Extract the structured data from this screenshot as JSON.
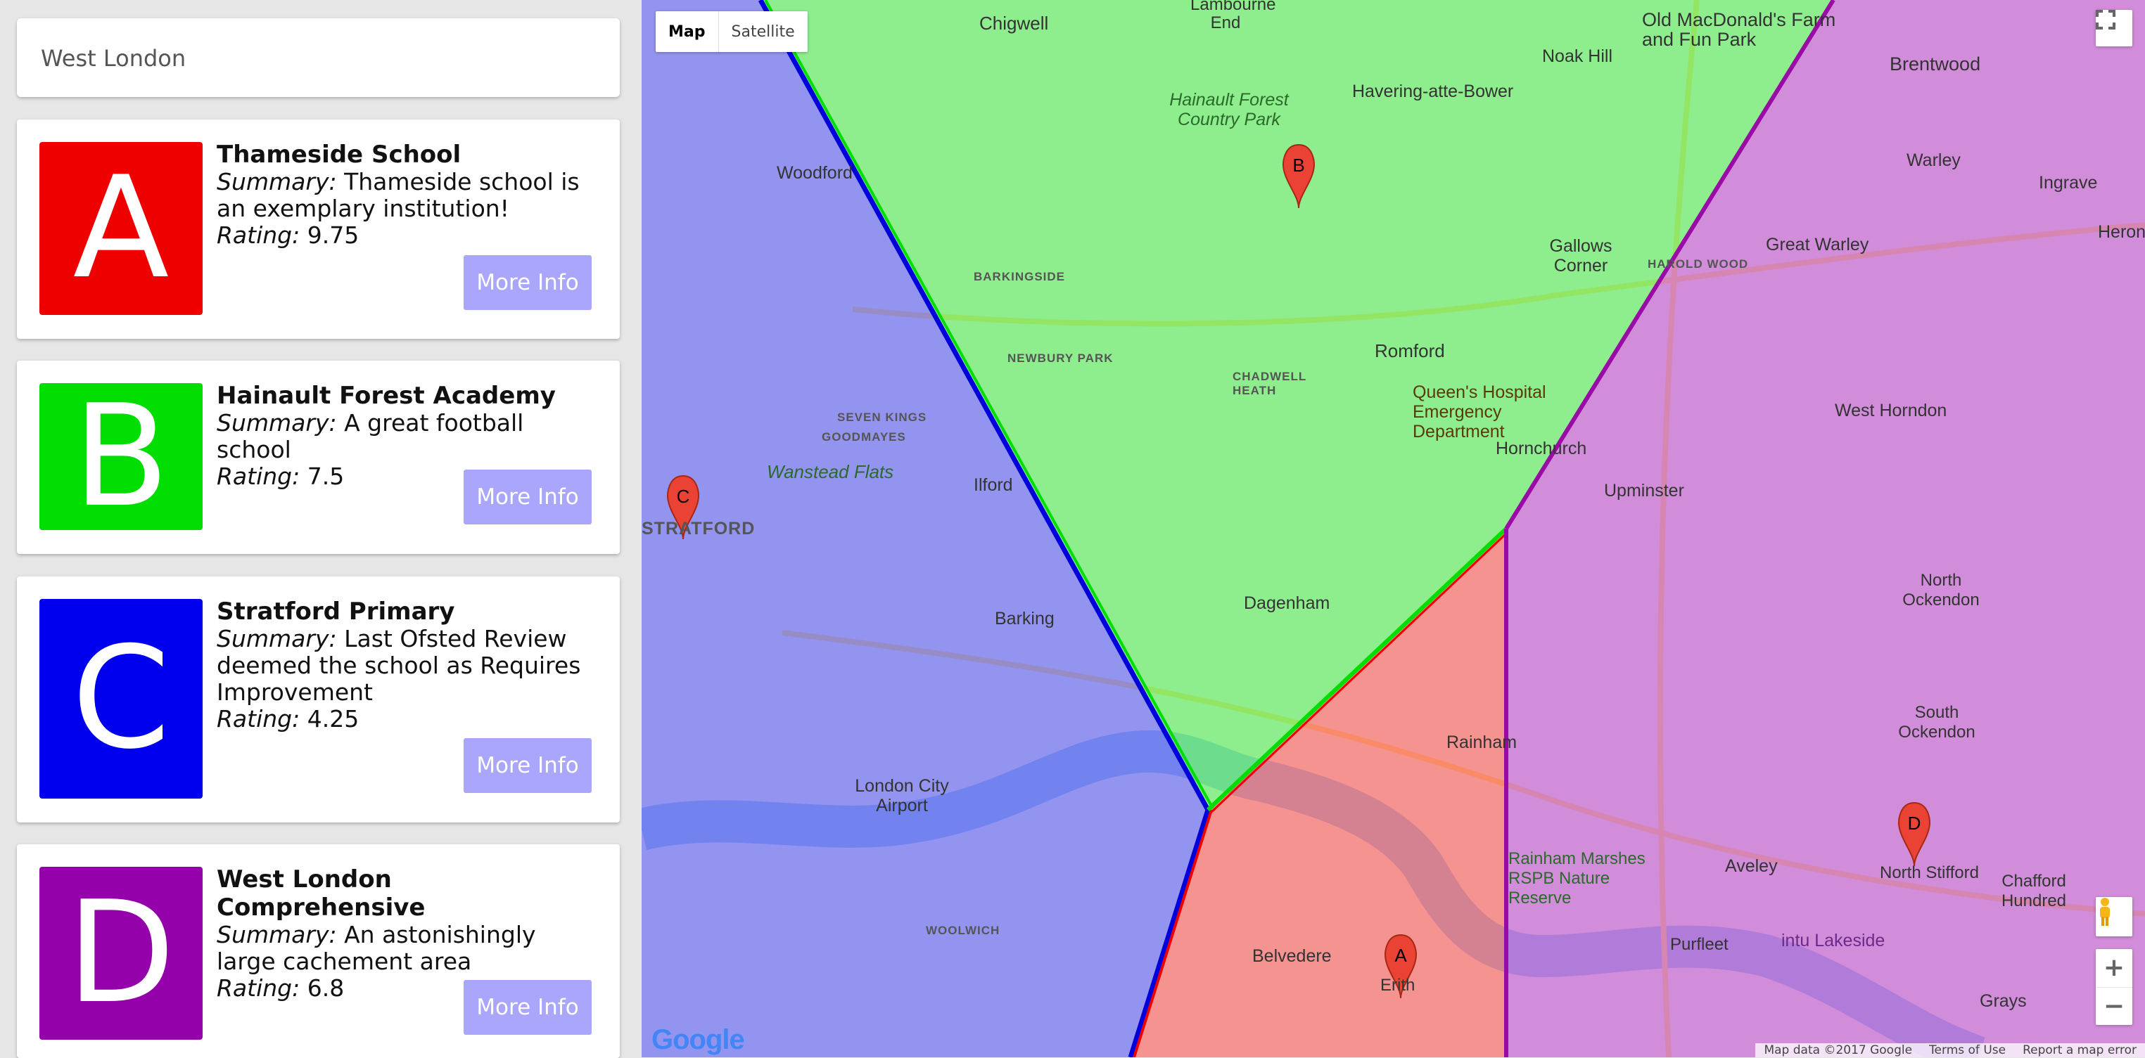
{
  "search": {
    "value": "West London"
  },
  "schools": [
    {
      "letter": "A",
      "color": "#ee0000",
      "name": "Thameside School",
      "summary_label": "Summary:",
      "summary": "Thameside school is an exemplary institution!",
      "rating_label": "Rating:",
      "rating": "9.75",
      "button": "More Info"
    },
    {
      "letter": "B",
      "color": "#00dd00",
      "name": "Hainault Forest Academy",
      "summary_label": "Summary:",
      "summary": "A great football school",
      "rating_label": "Rating:",
      "rating": "7.5",
      "button": "More Info"
    },
    {
      "letter": "C",
      "color": "#0000ee",
      "name": "Stratford Primary",
      "summary_label": "Summary:",
      "summary": "Last Ofsted Review deemed the school as Requires Improvement",
      "rating_label": "Rating:",
      "rating": "4.25",
      "button": "More Info"
    },
    {
      "letter": "D",
      "color": "#9400aa",
      "name": "West London Comprehensive",
      "summary_label": "Summary:",
      "summary": "An astonishingly large cachement area",
      "rating_label": "Rating:",
      "rating": "6.8",
      "button": "More Info"
    }
  ],
  "map": {
    "type_buttons": [
      "Map",
      "Satellite"
    ],
    "region_colors": {
      "A": "#ff4a4a",
      "B": "#44f044",
      "C": "#4c4cf5",
      "D": "#c040d0"
    },
    "places": [
      "Chigwell",
      "Lambourne End",
      "Havering-atte-Bower",
      "Noak Hill",
      "Old MacDonald's Farm and Fun Park",
      "Brentwood",
      "Hainault Forest Country Park",
      "Woodford",
      "Gallows Corner",
      "Great Warley",
      "Romford",
      "Queen's Hospital Emergency Department",
      "West Horndon",
      "Hornchurch",
      "Upminster",
      "Wanstead Flats",
      "Ilford",
      "Barking",
      "Dagenham",
      "North Ockendon",
      "South Ockendon",
      "Rainham",
      "London City Airport",
      "Rainham Marshes RSPB Nature Reserve",
      "Aveley",
      "North Stifford",
      "Chafford Hundred",
      "Purfleet",
      "intu Lakeside",
      "Belvedere",
      "Erith",
      "Grays",
      "STRATFORD",
      "WOOLWICH",
      "GOODMAYES",
      "SEVEN KINGS",
      "CHADWELL HEATH",
      "NEWBURY PARK",
      "BARKINGSIDE",
      "HAROLD WOOD",
      "Ingrave",
      "Warley",
      "Herongate"
    ],
    "marker_labels": [
      "A",
      "B",
      "C",
      "D"
    ],
    "footer": [
      "Map data ©2017 Google",
      "Terms of Use",
      "Report a map error"
    ],
    "logo": "Google"
  }
}
